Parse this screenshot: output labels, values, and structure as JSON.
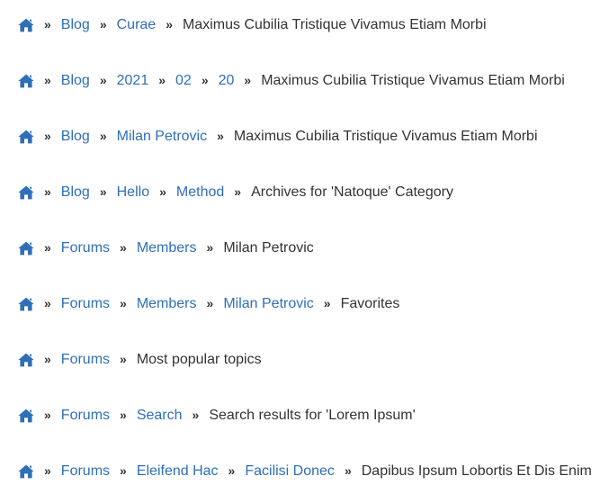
{
  "accent_color": "#2f6fb7",
  "text_color": "#333333",
  "home_icon": "home-icon",
  "separator": "»",
  "breadcrumbs": [
    {
      "links": [
        "Blog",
        "Curae"
      ],
      "current": "Maximus Cubilia Tristique Vivamus Etiam Morbi"
    },
    {
      "links": [
        "Blog",
        "2021",
        "02",
        "20"
      ],
      "current": "Maximus Cubilia Tristique Vivamus Etiam Morbi"
    },
    {
      "links": [
        "Blog",
        "Milan Petrovic"
      ],
      "current": "Maximus Cubilia Tristique Vivamus Etiam Morbi"
    },
    {
      "links": [
        "Blog",
        "Hello",
        "Method"
      ],
      "current": "Archives for 'Natoque' Category"
    },
    {
      "links": [
        "Forums",
        "Members"
      ],
      "current": "Milan Petrovic"
    },
    {
      "links": [
        "Forums",
        "Members",
        "Milan Petrovic"
      ],
      "current": "Favorites"
    },
    {
      "links": [
        "Forums"
      ],
      "current": "Most popular topics"
    },
    {
      "links": [
        "Forums",
        "Search"
      ],
      "current": "Search results for 'Lorem Ipsum'"
    },
    {
      "links": [
        "Forums",
        "Eleifend Hac",
        "Facilisi Donec"
      ],
      "current": "Dapibus Ipsum Lobortis Et Dis Enim"
    }
  ]
}
